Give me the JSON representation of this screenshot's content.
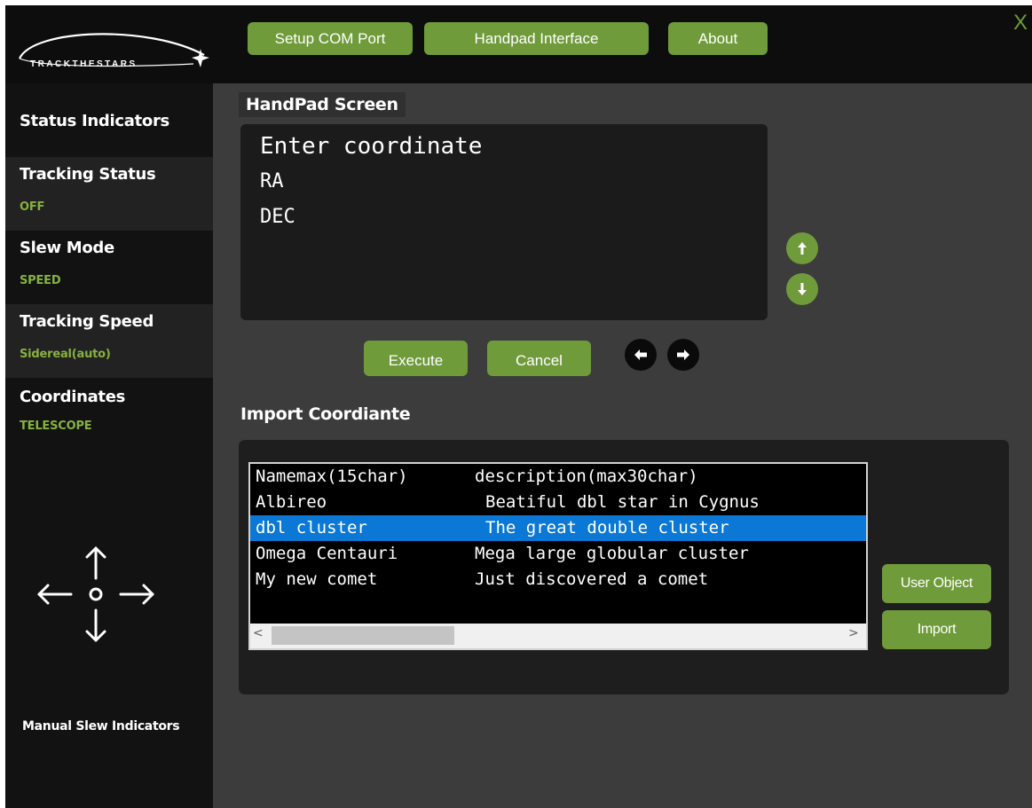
{
  "brand": {
    "logo_text": "TRACKTHESTARS"
  },
  "topbar": {
    "buttons": [
      "Setup COM Port",
      "Handpad Interface",
      "About"
    ],
    "close_label": "X"
  },
  "sidebar": {
    "status_heading": "Status Indicators",
    "items": [
      {
        "label": "Tracking Status",
        "value": "OFF"
      },
      {
        "label": "Slew Mode",
        "value": "SPEED"
      },
      {
        "label": "Tracking Speed",
        "value": "Sidereal(auto)"
      },
      {
        "label": "Coordinates",
        "value": "TELESCOPE"
      }
    ],
    "slew_indicators_label": "Manual Slew Indicators"
  },
  "handpad": {
    "title": "HandPad Screen",
    "lines": [
      "Enter coordinate",
      "RA",
      "DEC"
    ],
    "execute_label": "Execute",
    "cancel_label": "Cancel"
  },
  "import": {
    "title": "Import Coordiante",
    "rows": [
      {
        "name": "Namemax(15char)",
        "desc": "description(max30char)"
      },
      {
        "name": "Albireo",
        "desc": "Beatiful dbl star in Cygnus"
      },
      {
        "name": "dbl cluster",
        "desc": "The great double cluster"
      },
      {
        "name": "Omega Centauri",
        "desc": "Mega large globular cluster"
      },
      {
        "name": "My new comet",
        "desc": "Just discovered a comet"
      }
    ],
    "selected_index": 2,
    "scroll_left": "<",
    "scroll_right": ">",
    "user_object_label": "User Object",
    "import_label": "Import"
  },
  "colors": {
    "accent_green": "#6f9b3a",
    "status_value_green": "#86b13e",
    "selection_blue": "#0a78d4"
  }
}
